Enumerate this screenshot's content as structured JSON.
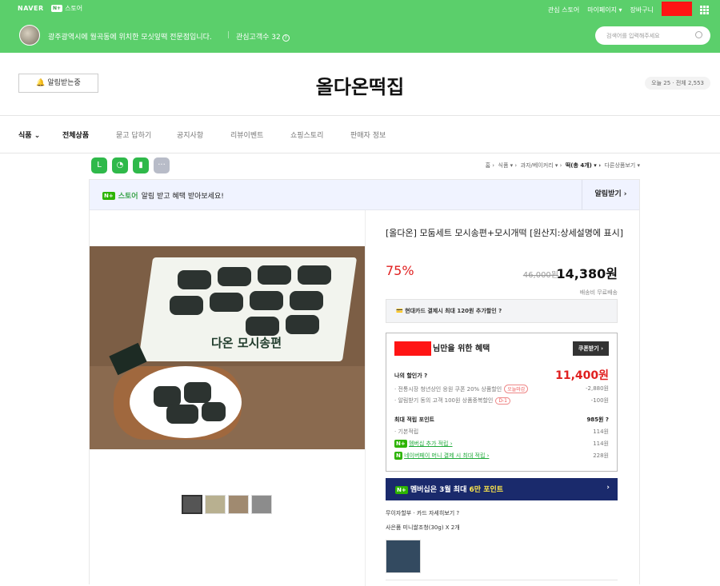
{
  "topbar": {
    "naver": "NAVER",
    "store_badge": "N+",
    "store_label": "스토어",
    "right_links": [
      "관심 스토어",
      "마이페이지 ▾",
      "장바구니"
    ]
  },
  "storebar": {
    "description": "광주광역시에 월곡동에 위치한 모싯잎떡 전문점입니다.",
    "fans_label": "관심고객수 32",
    "search_placeholder": "검색어를 입력해주세요"
  },
  "header": {
    "alarm_button": "알림받는중",
    "store_name": "올다온떡집",
    "visits": "오늘 25 · 전체 2,553"
  },
  "nav": {
    "category": "식품 ⌄",
    "items": [
      "전체상품",
      "묻고 답하기",
      "공지사항",
      "리뷰이벤트",
      "쇼핑스토리",
      "판매자 정보"
    ]
  },
  "share": {
    "icons": [
      "line-icon",
      "kakaostory-icon",
      "bookmark-icon",
      "more-icon"
    ]
  },
  "breadcrumb": {
    "items": [
      "홈 ›",
      "식품 ▾ ›",
      "과자/베이커리 ▾ ›",
      "떡(총 4개) ▾ ›",
      "다른상품보기 ▾"
    ]
  },
  "alarmbar": {
    "store": "스토어",
    "text": "알림 받고 혜택 받아보세요!",
    "button": "알림받기 ›"
  },
  "image": {
    "box_text": "다온 모시송편"
  },
  "product": {
    "name": "[올다온] 모둠세트 모시송편+모시개떡 [원산지:상세설명에 표시]",
    "discount": "75%",
    "original_price": "46,000원",
    "price": "14,380원",
    "shipping": "배송비 무료배송",
    "card_offer": "네이버페이 포인트 현대카드 결제시 최대 120원 추가할인",
    "card_offer_visible": "현대카드 결제시 최대 120원 추가할인 ?"
  },
  "benefit": {
    "title": "님만을 위한 혜택",
    "coupon_button": "쿠폰받기 ›",
    "my_discount_label": "나의 할인가 ?",
    "my_discount_value": "11,400원",
    "row1_label": "· 전통시장 청년상인 응원 쿠폰 20% 상품할인",
    "row1_tag": "오늘마감",
    "row1_value": "-2,880원",
    "row2_label": "· 알림받기 동의 고객 100원 상품중복할인",
    "row2_tag": "D-1",
    "row2_value": "-100원",
    "points_label": "최대 적립 포인트",
    "points_value": "985원 ?",
    "base_label": "· 기본적립",
    "base_value": "114원",
    "member_label": "멤버십 추가 적립 ›",
    "member_value": "114원",
    "pay_label": "네이버페이 머니 결제 시 최대 적립 ›",
    "pay_value": "228원"
  },
  "membership": {
    "text": "멤버십은 3월 최대",
    "highlight": "6만 포인트",
    "chevron": "›"
  },
  "extra": {
    "installment": "무이자할부 · 카드 자세히보기 ?",
    "gift": "사은품 미니쌀조청(30g) X 2개"
  }
}
